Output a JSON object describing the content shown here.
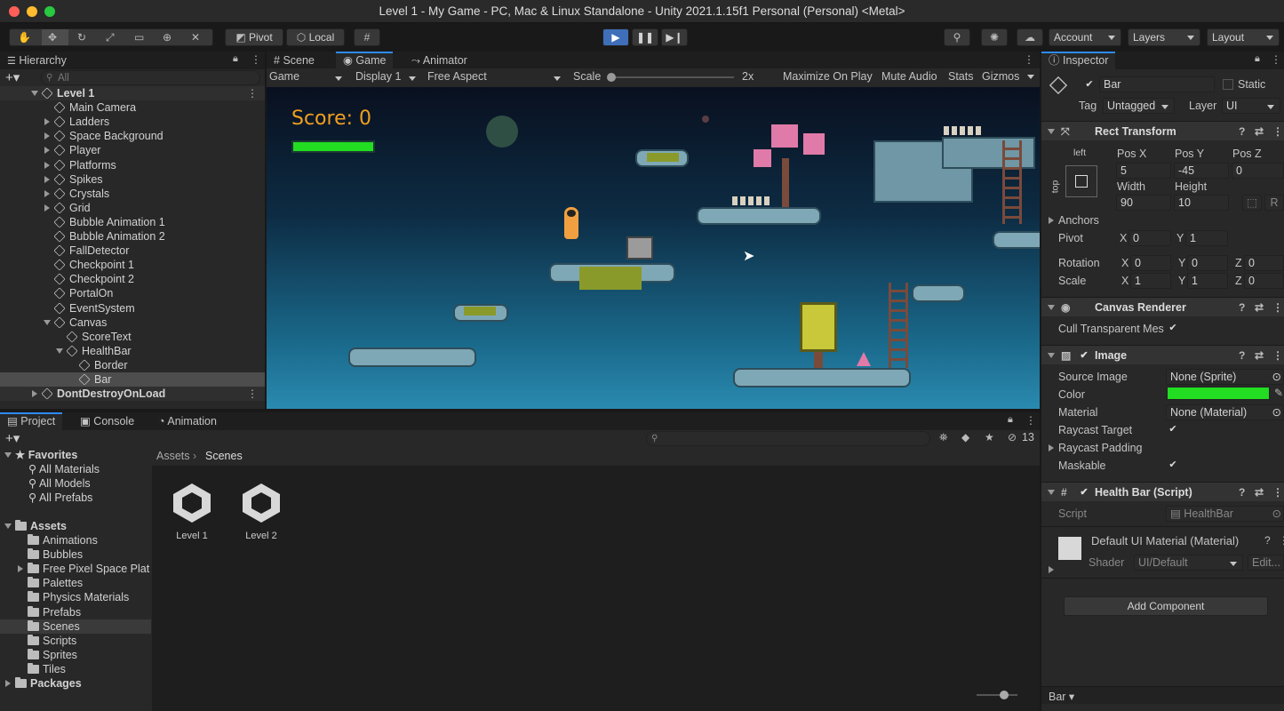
{
  "window": {
    "title": "Level 1 - My Game - PC, Mac & Linux Standalone - Unity 2021.1.15f1 Personal (Personal) <Metal>"
  },
  "toolbar": {
    "pivot": "Pivot",
    "local": "Local",
    "account": "Account",
    "layers": "Layers",
    "layout": "Layout"
  },
  "hierarchy": {
    "tab": "Hierarchy",
    "search_placeholder": "All",
    "items": [
      {
        "label": "Level 1",
        "depth": 0,
        "expand": "open",
        "scene": true
      },
      {
        "label": "Main Camera",
        "depth": 1,
        "expand": "none"
      },
      {
        "label": "Ladders",
        "depth": 1,
        "expand": "closed"
      },
      {
        "label": "Space Background",
        "depth": 1,
        "expand": "closed"
      },
      {
        "label": "Player",
        "depth": 1,
        "expand": "closed"
      },
      {
        "label": "Platforms",
        "depth": 1,
        "expand": "closed"
      },
      {
        "label": "Spikes",
        "depth": 1,
        "expand": "closed"
      },
      {
        "label": "Crystals",
        "depth": 1,
        "expand": "closed"
      },
      {
        "label": "Grid",
        "depth": 1,
        "expand": "closed"
      },
      {
        "label": "Bubble Animation 1",
        "depth": 1,
        "expand": "none"
      },
      {
        "label": "Bubble Animation 2",
        "depth": 1,
        "expand": "none"
      },
      {
        "label": "FallDetector",
        "depth": 1,
        "expand": "none"
      },
      {
        "label": "Checkpoint 1",
        "depth": 1,
        "expand": "none"
      },
      {
        "label": "Checkpoint 2",
        "depth": 1,
        "expand": "none"
      },
      {
        "label": "PortalOn",
        "depth": 1,
        "expand": "none"
      },
      {
        "label": "EventSystem",
        "depth": 1,
        "expand": "none"
      },
      {
        "label": "Canvas",
        "depth": 1,
        "expand": "open"
      },
      {
        "label": "ScoreText",
        "depth": 2,
        "expand": "none"
      },
      {
        "label": "HealthBar",
        "depth": 2,
        "expand": "open"
      },
      {
        "label": "Border",
        "depth": 3,
        "expand": "none"
      },
      {
        "label": "Bar",
        "depth": 3,
        "expand": "none",
        "selected": true
      },
      {
        "label": "DontDestroyOnLoad",
        "depth": 0,
        "expand": "closed",
        "scene": true
      }
    ]
  },
  "game": {
    "tabs": [
      "Scene",
      "Game",
      "Animator"
    ],
    "dropdown_game": "Game",
    "dropdown_display": "Display 1",
    "dropdown_aspect": "Free Aspect",
    "scale_label": "Scale",
    "scale_value": "2x",
    "maximize": "Maximize On Play",
    "mute": "Mute Audio",
    "stats": "Stats",
    "gizmos": "Gizmos",
    "score_text": "Score: 0",
    "health_fraction": 1.0
  },
  "project": {
    "tabs": [
      "Project",
      "Console",
      "Animation"
    ],
    "badge": "13",
    "favorites_label": "Favorites",
    "favorites": [
      "All Materials",
      "All Models",
      "All Prefabs"
    ],
    "assets_label": "Assets",
    "folders": [
      {
        "label": "Animations",
        "expand": "none"
      },
      {
        "label": "Bubbles",
        "expand": "none"
      },
      {
        "label": "Free Pixel Space Plat",
        "expand": "closed"
      },
      {
        "label": "Palettes",
        "expand": "none"
      },
      {
        "label": "Physics Materials",
        "expand": "none"
      },
      {
        "label": "Prefabs",
        "expand": "none"
      },
      {
        "label": "Scenes",
        "expand": "none",
        "selected": true
      },
      {
        "label": "Scripts",
        "expand": "none"
      },
      {
        "label": "Sprites",
        "expand": "none"
      },
      {
        "label": "Tiles",
        "expand": "none"
      }
    ],
    "packages_label": "Packages",
    "breadcrumb": [
      "Assets",
      "Scenes"
    ],
    "files": [
      "Level 1",
      "Level 2"
    ]
  },
  "inspector": {
    "tab": "Inspector",
    "name": "Bar",
    "static_label": "Static",
    "tag_label": "Tag",
    "tag_value": "Untagged",
    "layer_label": "Layer",
    "layer_value": "UI",
    "rect": {
      "title": "Rect Transform",
      "anchor_h": "left",
      "anchor_v": "top",
      "posx_label": "Pos X",
      "posy_label": "Pos Y",
      "posz_label": "Pos Z",
      "posx": "5",
      "posy": "-45",
      "posz": "0",
      "width_label": "Width",
      "height_label": "Height",
      "width": "90",
      "height": "10",
      "r_btn": "R",
      "anchors_label": "Anchors",
      "pivot_label": "Pivot",
      "pivot_x": "0",
      "pivot_y": "1",
      "rotation_label": "Rotation",
      "rot_x": "0",
      "rot_y": "0",
      "rot_z": "0",
      "scale_label": "Scale",
      "scale_x": "1",
      "scale_y": "1",
      "scale_z": "0",
      "x": "X",
      "y": "Y",
      "z": "Z"
    },
    "canvas_renderer": {
      "title": "Canvas Renderer",
      "cull_label": "Cull Transparent Mes"
    },
    "image": {
      "title": "Image",
      "source_label": "Source Image",
      "source_value": "None (Sprite)",
      "color_label": "Color",
      "color_value": "#22dd22",
      "material_label": "Material",
      "material_value": "None (Material)",
      "raycast_label": "Raycast Target",
      "padding_label": "Raycast Padding",
      "maskable_label": "Maskable"
    },
    "script_comp": {
      "title": "Health Bar (Script)",
      "script_label": "Script",
      "script_value": "HealthBar"
    },
    "material": {
      "title": "Default UI Material (Material)",
      "shader_label": "Shader",
      "shader_value": "UI/Default",
      "edit": "Edit..."
    },
    "add_component": "Add Component",
    "footer": "Bar"
  }
}
